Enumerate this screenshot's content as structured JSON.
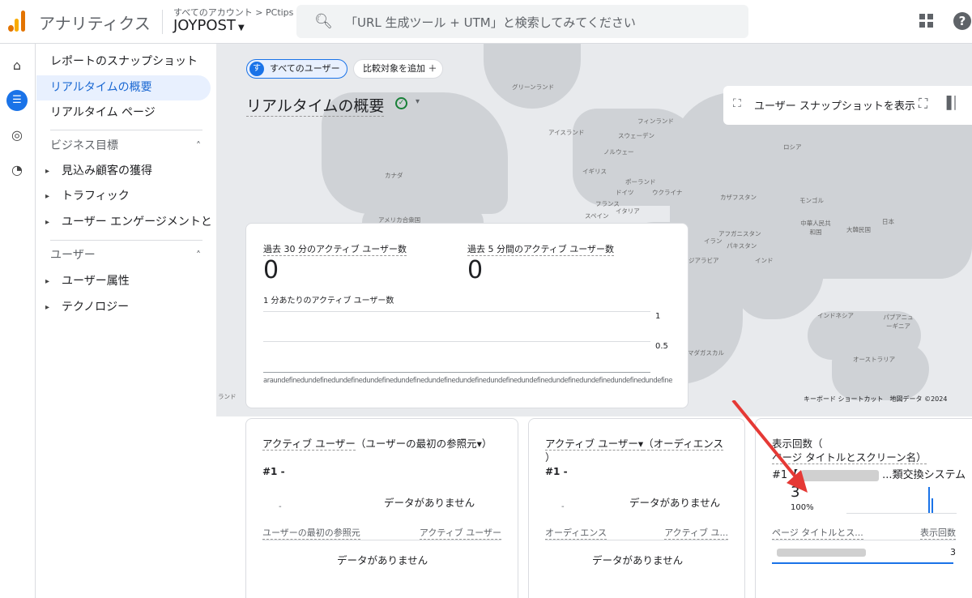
{
  "header": {
    "app_title": "アナリティクス",
    "account_path": "すべてのアカウント > PCtips",
    "account_name": "JOYPOST",
    "search_placeholder": "「URL 生成ツール + UTM」と検索してみてください"
  },
  "nav": {
    "items": [
      {
        "label": "レポートのスナップショット"
      },
      {
        "label": "リアルタイムの概要"
      },
      {
        "label": "リアルタイム ページ"
      },
      {
        "label": "ビジネス目標"
      },
      {
        "label": "見込み顧客の獲得"
      },
      {
        "label": "トラフィック"
      },
      {
        "label": "ユーザー エンゲージメントと..."
      },
      {
        "label": "ユーザー"
      },
      {
        "label": "ユーザー属性"
      },
      {
        "label": "テクノロジー"
      }
    ]
  },
  "toolbar": {
    "segment_badge": "す",
    "segment_label": "すべてのユーザー",
    "add_compare_label": "比較対象を追加 ＋",
    "page_title": "リアルタイムの概要",
    "snapshot_label": "ユーザー スナップショットを表示"
  },
  "map": {
    "labels": [
      "グリーンランド",
      "アイスランド",
      "フィンランド",
      "スウェーデン",
      "ノルウェー",
      "ロシア",
      "カナダ",
      "イギリス",
      "ポーランド",
      "ドイツ",
      "ウクライナ",
      "フランス",
      "イタリア",
      "スペイン",
      "カザフスタン",
      "モンゴル",
      "アメリカ合衆国",
      "中華人民共和国",
      "日本",
      "大韓民国",
      "アフガニスタン",
      "イラン",
      "パキスタン",
      "サウジアラビア",
      "インド",
      "インドネシア",
      "パプアニューギニア",
      "オーストラリア",
      "マダガスカル",
      "ランド"
    ],
    "footer": "キーボード ショートカット　地図データ ©2024"
  },
  "summary": {
    "metric1_label": "過去 30 分のアクティブ ユーザー数",
    "metric1_value": "0",
    "metric2_label": "過去 5 分間のアクティブ ユーザー数",
    "metric2_value": "0",
    "per_minute_label": "1 分あたりのアクティブ ユーザー数",
    "y_tick_1": "1",
    "y_tick_05": "0.5",
    "x_axis_text": "araundefinedundefinedundefinedundefinedundefinedundefinedundefinedundefinedundefinedundefinedundefinedundefinedundefinedundefinedundefinedundefinedundefinedundefined - minut"
  },
  "card1": {
    "title_prefix": "アクティブ ユーザー",
    "title_suffix": "（ユーザーの最初の参照元▾）",
    "rank": "#1 -",
    "no_data": "データがありません",
    "dash": "-",
    "col1": "ユーザーの最初の参照元",
    "col2": "アクティブ ユーザー",
    "no_data2": "データがありません"
  },
  "card2": {
    "title_prefix": "アクティブ ユーザー▾",
    "title_suffix": "（オーディエンス",
    "title_line2": "）",
    "rank": "#1 -",
    "no_data": "データがありません",
    "dash": "-",
    "col1": "オーディエンス",
    "col2": "アクティブ ユ...",
    "no_data2": "データがありません"
  },
  "card3": {
    "title_line1": "表示回数（",
    "title_line2": "ページ タイトルとスクリーン名）",
    "rank_prefix": "#1【",
    "rank_suffix": "...類交換システム",
    "value": "3",
    "percent": "100%",
    "col1": "ページ タイトルとス...",
    "col2": "表示回数",
    "row_value": "3"
  }
}
